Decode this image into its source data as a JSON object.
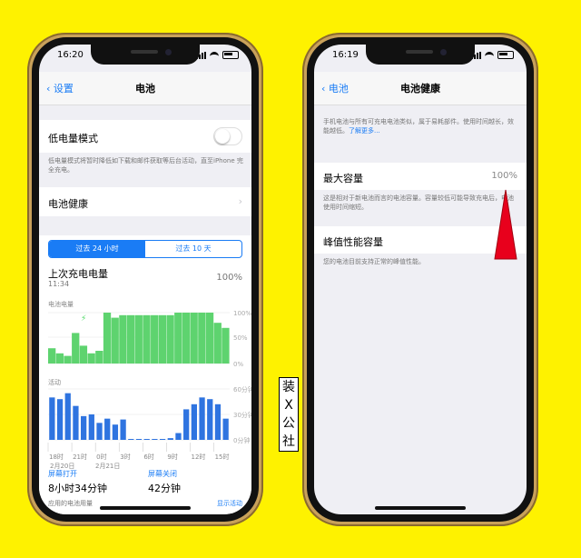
{
  "label_tag": [
    "装",
    "X",
    "公",
    "社"
  ],
  "left": {
    "status_time": "16:20",
    "nav_back": "设置",
    "nav_title": "电池",
    "low_power_label": "低电量模式",
    "low_power_desc": "低电量模式将暂时降低如下载和邮件获取等后台活动，直至iPhone 完全充电。",
    "battery_health_label": "电池健康",
    "seg_24h": "过去 24 小时",
    "seg_10d": "过去 10 天",
    "last_charge_label": "上次充电电量",
    "last_charge_time": "11:34",
    "last_charge_value": "100%",
    "level_title": "电池电量",
    "level_ticks": [
      "100%",
      "50%",
      "0%"
    ],
    "activity_title": "活动",
    "activity_ticks": [
      "60分钟",
      "30分钟",
      "0分钟"
    ],
    "x_ticks": [
      "18时",
      "21时",
      "0时",
      "3时",
      "6时",
      "9时",
      "12时",
      "15时"
    ],
    "date_labels": [
      "2月20日",
      "2月21日"
    ],
    "screen_on_label": "屏幕打开",
    "screen_on_value": "8小时34分钟",
    "screen_off_label": "屏幕关闭",
    "screen_off_value": "42分钟",
    "app_usage_label": "应用的电池用量",
    "show_activity": "显示活动"
  },
  "right": {
    "status_time": "16:19",
    "nav_back": "电池",
    "nav_title": "电池健康",
    "intro": "手机电池与所有可充电电池类似，属于易耗部件。使用时间越长，效能越低。",
    "learn_more": "了解更多...",
    "max_capacity_label": "最大容量",
    "max_capacity_value": "100%",
    "max_capacity_desc": "这是相对于新电池而言的电池容量。容量较低可能导致充电后，电池使用时间缩短。",
    "peak_label": "峰值性能容量",
    "peak_desc": "您的电池目前支持正常的峰值性能。"
  },
  "colors": {
    "accent": "#1a7cf5",
    "charge_green": "#4cd964",
    "arrow_red": "#e8001c",
    "background": "#fef200"
  },
  "chart_data": [
    {
      "type": "area",
      "title": "电池电量",
      "y_unit": "%",
      "ylim": [
        0,
        100
      ],
      "x": [
        "18时",
        "19时",
        "20时",
        "21时",
        "22时",
        "23时",
        "0时",
        "1时",
        "2时",
        "3时",
        "4时",
        "5时",
        "6时",
        "7时",
        "8时",
        "9时",
        "10时",
        "11时",
        "12时",
        "13时",
        "14时",
        "15时",
        "16时"
      ],
      "values": [
        30,
        20,
        15,
        60,
        35,
        20,
        25,
        100,
        90,
        95,
        95,
        95,
        95,
        95,
        95,
        95,
        100,
        100,
        100,
        100,
        100,
        80,
        70
      ]
    },
    {
      "type": "bar",
      "title": "活动",
      "y_unit": "分钟",
      "ylim": [
        0,
        60
      ],
      "x": [
        "18时",
        "19时",
        "20时",
        "21时",
        "22时",
        "23时",
        "0时",
        "1时",
        "2时",
        "3时",
        "4时",
        "5时",
        "6时",
        "7时",
        "8时",
        "9时",
        "10时",
        "11时",
        "12时",
        "13时",
        "14时",
        "15时",
        "16时"
      ],
      "values": [
        50,
        48,
        55,
        40,
        28,
        30,
        20,
        25,
        18,
        24,
        1,
        1,
        1,
        1,
        1,
        2,
        8,
        36,
        42,
        50,
        48,
        42,
        25
      ]
    }
  ]
}
